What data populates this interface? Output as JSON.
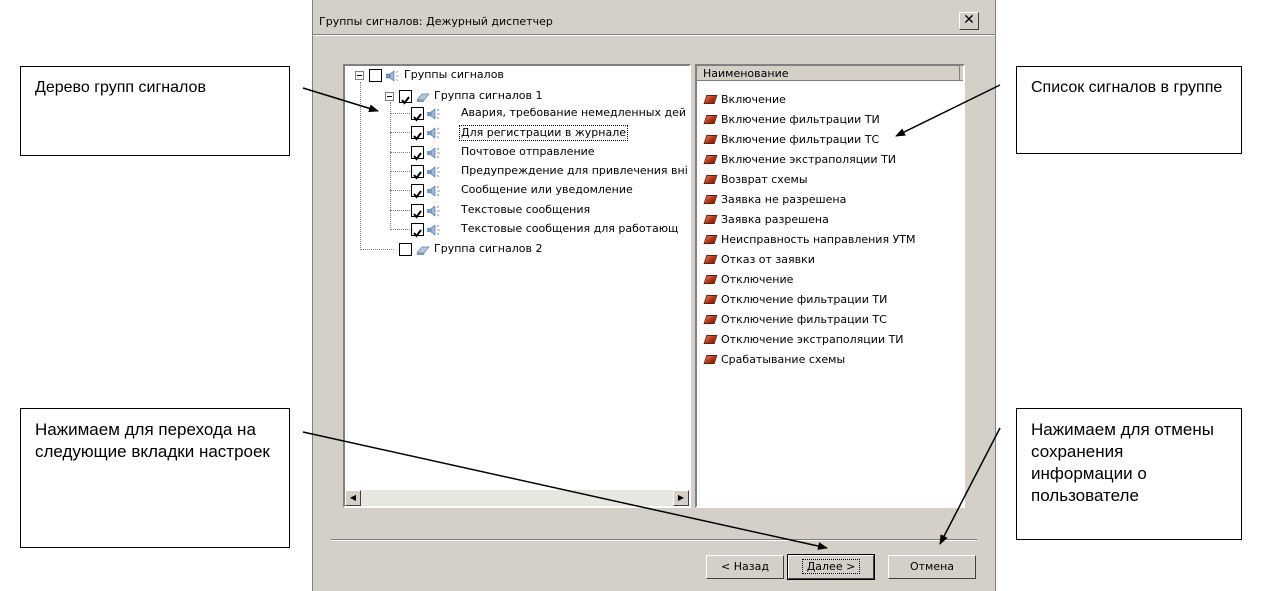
{
  "dialog": {
    "title": "Группы сигналов: Дежурный диспетчер",
    "close_glyph": "✕"
  },
  "tree": {
    "root": {
      "label": "Группы сигналов",
      "checked": false,
      "icon": "speaker-icon"
    },
    "groups": [
      {
        "label": "Группа сигналов 1",
        "checked": true,
        "icon": "eraser-icon",
        "children": [
          {
            "label": "Авария, требование немедленных дей",
            "checked": true
          },
          {
            "label": "Для регистрации в журнале",
            "checked": true,
            "selected": true
          },
          {
            "label": "Почтовое отправление",
            "checked": true
          },
          {
            "label": "Предупреждение для привлечения вні",
            "checked": true
          },
          {
            "label": "Сообщение или уведомление",
            "checked": true
          },
          {
            "label": "Текстовые сообщения",
            "checked": true
          },
          {
            "label": "Текстовые сообщения для работающ",
            "checked": true
          }
        ]
      },
      {
        "label": "Группа сигналов 2",
        "checked": false,
        "icon": "eraser-icon"
      }
    ]
  },
  "signal_list": {
    "header": "Наименование",
    "items": [
      "Включение",
      "Включение фильтрации ТИ",
      "Включение фильтрации ТС",
      "Включение экстраполяции ТИ",
      "Возврат схемы",
      "Заявка не разрешена",
      "Заявка разрешена",
      "Неисправность направления УТМ",
      "Отказ от заявки",
      "Отключение",
      "Отключение фильтрации ТИ",
      "Отключение фильтрации ТС",
      "Отключение экстраполяции ТИ",
      "Срабатывание схемы"
    ]
  },
  "buttons": {
    "back": "< Назад",
    "next": "Далее >",
    "cancel": "Отмена"
  },
  "callouts": {
    "tree": "Дерево групп сигналов",
    "list": "Список сигналов в группе",
    "next": "Нажимаем для перехода на следующие вкладки настроек",
    "cancel": "Нажимаем для отмены сохранения информации о пользователе"
  },
  "colors": {
    "dialog_bg": "#d4d0c8",
    "signal_icon": "#b03010"
  }
}
